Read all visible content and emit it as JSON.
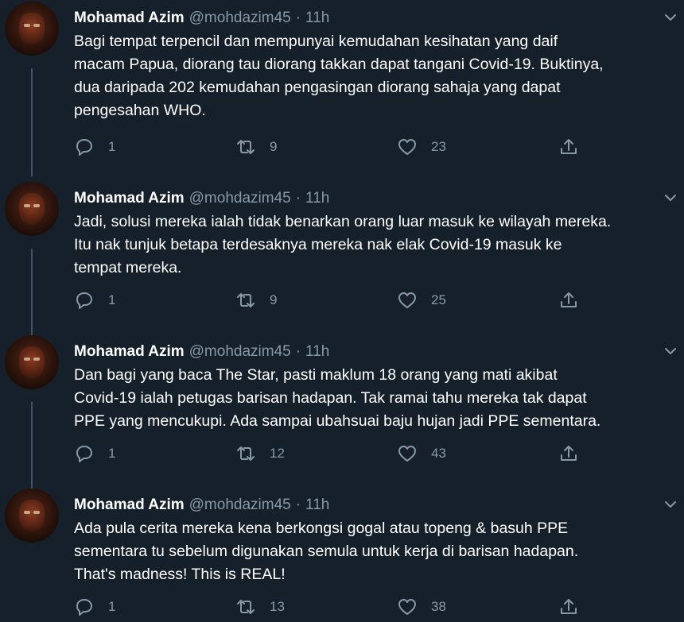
{
  "tweets": [
    {
      "name": "Mohamad Azim",
      "handle": "@mohdazim45",
      "separator": "·",
      "time": "11h",
      "text": "Bagi tempat terpencil dan mempunyai kemudahan kesihatan yang daif\nmacam Papua, diorang tau diorang takkan dapat tangani Covid-19. Buktinya,\ndua daripada 202 kemudahan pengasingan diorang sahaja yang dapat\npengesahan WHO.",
      "replies": "1",
      "retweets": "9",
      "likes": "23"
    },
    {
      "name": "Mohamad Azim",
      "handle": "@mohdazim45",
      "separator": "·",
      "time": "11h",
      "text": "Jadi, solusi mereka ialah tidak benarkan orang luar masuk ke wilayah mereka.\nItu nak tunjuk betapa terdesaknya mereka nak elak Covid-19 masuk ke\ntempat mereka.",
      "replies": "1",
      "retweets": "9",
      "likes": "25"
    },
    {
      "name": "Mohamad Azim",
      "handle": "@mohdazim45",
      "separator": "·",
      "time": "11h",
      "text": "Dan bagi yang baca The Star, pasti maklum 18 orang yang mati akibat\nCovid-19 ialah petugas barisan hadapan. Tak ramai tahu mereka tak dapat\nPPE yang mencukupi. Ada sampai ubahsuai baju hujan jadi PPE sementara.",
      "replies": "1",
      "retweets": "12",
      "likes": "43"
    },
    {
      "name": "Mohamad Azim",
      "handle": "@mohdazim45",
      "separator": "·",
      "time": "11h",
      "text": "Ada pula cerita mereka kena berkongsi gogal atau topeng & basuh PPE\nsementara tu sebelum digunakan semula untuk kerja di barisan hadapan.\nThat's madness! This is REAL!",
      "replies": "1",
      "retweets": "13",
      "likes": "38"
    }
  ],
  "colors": {
    "background": "#15202b",
    "muted": "#8899a6",
    "thread_line": "#3d5466"
  },
  "icons": {
    "reply": "reply-icon",
    "retweet": "retweet-icon",
    "like": "like-icon",
    "share": "share-icon",
    "more": "chevron-down-icon"
  }
}
